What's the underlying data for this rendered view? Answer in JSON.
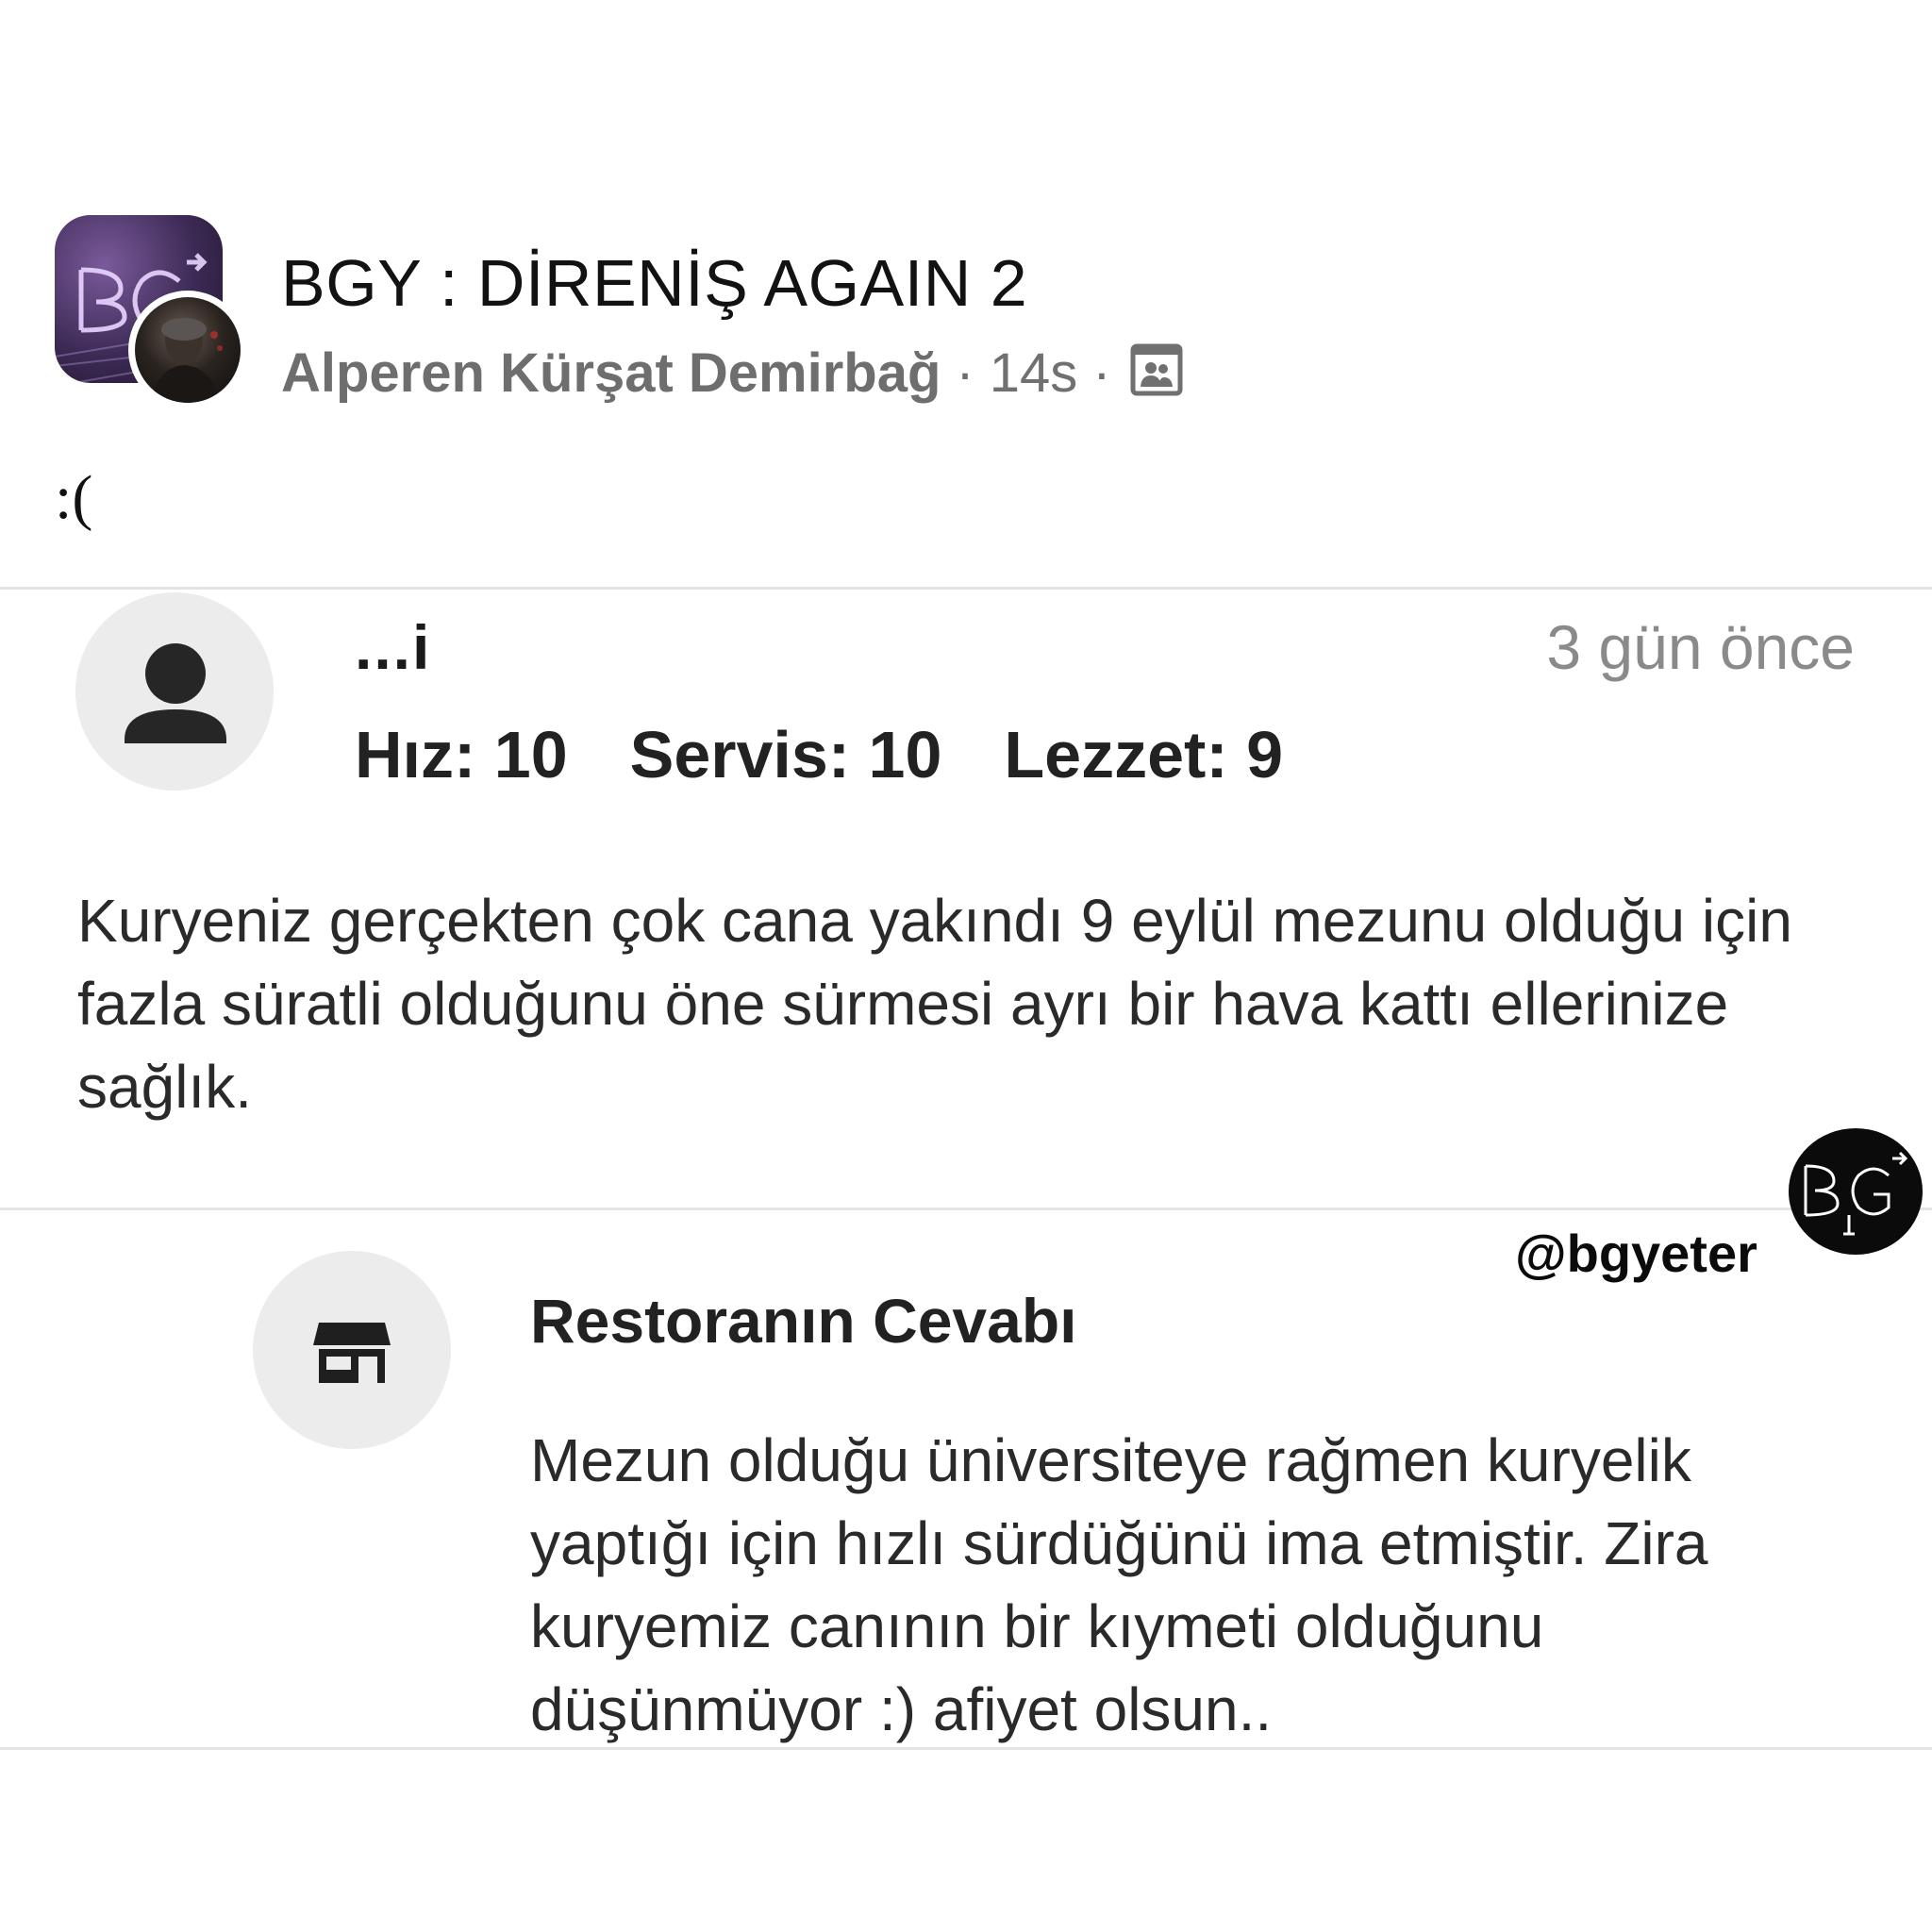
{
  "post": {
    "group_name": "BGY : DİRENİŞ AGAIN 2",
    "author": "Alperen Kürşat Demirbağ",
    "time": "14s",
    "separator": "·",
    "text": ":(",
    "audience_icon": "group-members-icon"
  },
  "review": {
    "reviewer_name": "...i",
    "date": "3 gün önce",
    "scores": [
      {
        "label": "Hız: 10"
      },
      {
        "label": "Servis: 10"
      },
      {
        "label": "Lezzet: 9"
      }
    ],
    "text": "Kuryeniz gerçekten çok cana yakındı 9 eylül mezunu olduğu için fazla süratli olduğunu öne sürmesi ayrı bir hava kattı ellerinize sağlık.",
    "avatar_icon": "person-icon"
  },
  "reply": {
    "title": "Restoranın Cevabı",
    "text": "Mezun olduğu üniversiteye rağmen kuryelik yaptığı için hızlı sürdüğünü ima etmiştir. Zira kuryemiz canının bir kıymeti olduğunu düşünmüyor :) afiyet olsun..",
    "avatar_icon": "store-icon"
  },
  "watermark": {
    "handle": "@bgyeter"
  },
  "colors": {
    "text_primary": "#111111",
    "text_secondary": "#707070",
    "avatar_bg": "#ececec",
    "divider": "#e4e4e4"
  }
}
